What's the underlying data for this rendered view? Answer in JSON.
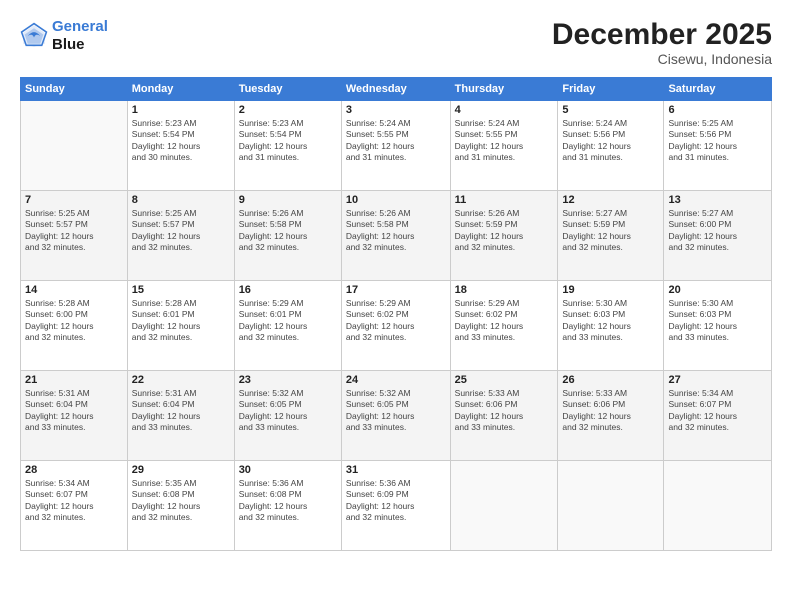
{
  "header": {
    "logo_line1": "General",
    "logo_line2": "Blue",
    "main_title": "December 2025",
    "subtitle": "Cisewu, Indonesia"
  },
  "calendar": {
    "weekdays": [
      "Sunday",
      "Monday",
      "Tuesday",
      "Wednesday",
      "Thursday",
      "Friday",
      "Saturday"
    ],
    "rows": [
      [
        {
          "day": "",
          "info": ""
        },
        {
          "day": "1",
          "info": "Sunrise: 5:23 AM\nSunset: 5:54 PM\nDaylight: 12 hours\nand 30 minutes."
        },
        {
          "day": "2",
          "info": "Sunrise: 5:23 AM\nSunset: 5:54 PM\nDaylight: 12 hours\nand 31 minutes."
        },
        {
          "day": "3",
          "info": "Sunrise: 5:24 AM\nSunset: 5:55 PM\nDaylight: 12 hours\nand 31 minutes."
        },
        {
          "day": "4",
          "info": "Sunrise: 5:24 AM\nSunset: 5:55 PM\nDaylight: 12 hours\nand 31 minutes."
        },
        {
          "day": "5",
          "info": "Sunrise: 5:24 AM\nSunset: 5:56 PM\nDaylight: 12 hours\nand 31 minutes."
        },
        {
          "day": "6",
          "info": "Sunrise: 5:25 AM\nSunset: 5:56 PM\nDaylight: 12 hours\nand 31 minutes."
        }
      ],
      [
        {
          "day": "7",
          "info": "Sunrise: 5:25 AM\nSunset: 5:57 PM\nDaylight: 12 hours\nand 32 minutes."
        },
        {
          "day": "8",
          "info": "Sunrise: 5:25 AM\nSunset: 5:57 PM\nDaylight: 12 hours\nand 32 minutes."
        },
        {
          "day": "9",
          "info": "Sunrise: 5:26 AM\nSunset: 5:58 PM\nDaylight: 12 hours\nand 32 minutes."
        },
        {
          "day": "10",
          "info": "Sunrise: 5:26 AM\nSunset: 5:58 PM\nDaylight: 12 hours\nand 32 minutes."
        },
        {
          "day": "11",
          "info": "Sunrise: 5:26 AM\nSunset: 5:59 PM\nDaylight: 12 hours\nand 32 minutes."
        },
        {
          "day": "12",
          "info": "Sunrise: 5:27 AM\nSunset: 5:59 PM\nDaylight: 12 hours\nand 32 minutes."
        },
        {
          "day": "13",
          "info": "Sunrise: 5:27 AM\nSunset: 6:00 PM\nDaylight: 12 hours\nand 32 minutes."
        }
      ],
      [
        {
          "day": "14",
          "info": "Sunrise: 5:28 AM\nSunset: 6:00 PM\nDaylight: 12 hours\nand 32 minutes."
        },
        {
          "day": "15",
          "info": "Sunrise: 5:28 AM\nSunset: 6:01 PM\nDaylight: 12 hours\nand 32 minutes."
        },
        {
          "day": "16",
          "info": "Sunrise: 5:29 AM\nSunset: 6:01 PM\nDaylight: 12 hours\nand 32 minutes."
        },
        {
          "day": "17",
          "info": "Sunrise: 5:29 AM\nSunset: 6:02 PM\nDaylight: 12 hours\nand 32 minutes."
        },
        {
          "day": "18",
          "info": "Sunrise: 5:29 AM\nSunset: 6:02 PM\nDaylight: 12 hours\nand 33 minutes."
        },
        {
          "day": "19",
          "info": "Sunrise: 5:30 AM\nSunset: 6:03 PM\nDaylight: 12 hours\nand 33 minutes."
        },
        {
          "day": "20",
          "info": "Sunrise: 5:30 AM\nSunset: 6:03 PM\nDaylight: 12 hours\nand 33 minutes."
        }
      ],
      [
        {
          "day": "21",
          "info": "Sunrise: 5:31 AM\nSunset: 6:04 PM\nDaylight: 12 hours\nand 33 minutes."
        },
        {
          "day": "22",
          "info": "Sunrise: 5:31 AM\nSunset: 6:04 PM\nDaylight: 12 hours\nand 33 minutes."
        },
        {
          "day": "23",
          "info": "Sunrise: 5:32 AM\nSunset: 6:05 PM\nDaylight: 12 hours\nand 33 minutes."
        },
        {
          "day": "24",
          "info": "Sunrise: 5:32 AM\nSunset: 6:05 PM\nDaylight: 12 hours\nand 33 minutes."
        },
        {
          "day": "25",
          "info": "Sunrise: 5:33 AM\nSunset: 6:06 PM\nDaylight: 12 hours\nand 33 minutes."
        },
        {
          "day": "26",
          "info": "Sunrise: 5:33 AM\nSunset: 6:06 PM\nDaylight: 12 hours\nand 32 minutes."
        },
        {
          "day": "27",
          "info": "Sunrise: 5:34 AM\nSunset: 6:07 PM\nDaylight: 12 hours\nand 32 minutes."
        }
      ],
      [
        {
          "day": "28",
          "info": "Sunrise: 5:34 AM\nSunset: 6:07 PM\nDaylight: 12 hours\nand 32 minutes."
        },
        {
          "day": "29",
          "info": "Sunrise: 5:35 AM\nSunset: 6:08 PM\nDaylight: 12 hours\nand 32 minutes."
        },
        {
          "day": "30",
          "info": "Sunrise: 5:36 AM\nSunset: 6:08 PM\nDaylight: 12 hours\nand 32 minutes."
        },
        {
          "day": "31",
          "info": "Sunrise: 5:36 AM\nSunset: 6:09 PM\nDaylight: 12 hours\nand 32 minutes."
        },
        {
          "day": "",
          "info": ""
        },
        {
          "day": "",
          "info": ""
        },
        {
          "day": "",
          "info": ""
        }
      ]
    ]
  }
}
